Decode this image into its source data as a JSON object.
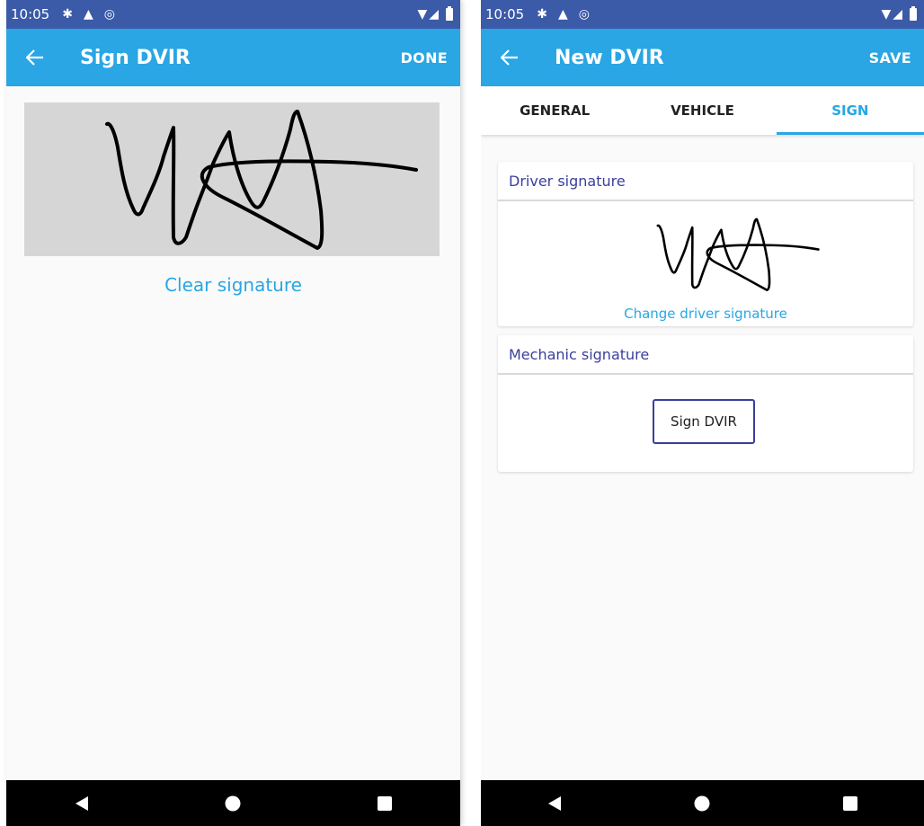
{
  "left": {
    "status_bar": {
      "time": "10:05",
      "icons": [
        "settings-icon",
        "alert-icon",
        "location-icon",
        "wifi-icon",
        "signal-icon",
        "battery-icon"
      ]
    },
    "app_bar": {
      "title": "Sign DVIR",
      "action": "DONE",
      "back_icon": "arrow-back-icon"
    },
    "clear_signature_label": "Clear signature",
    "nav_bar": {
      "icons": [
        "back-triangle-icon",
        "home-circle-icon",
        "recents-square-icon"
      ]
    }
  },
  "right": {
    "status_bar": {
      "time": "10:05",
      "icons": [
        "settings-icon",
        "alert-icon",
        "location-icon",
        "wifi-icon",
        "signal-icon",
        "battery-icon"
      ]
    },
    "app_bar": {
      "title": "New DVIR",
      "action": "SAVE",
      "back_icon": "arrow-back-icon"
    },
    "tabs": [
      {
        "label": "GENERAL",
        "active": false
      },
      {
        "label": "VEHICLE",
        "active": false
      },
      {
        "label": "SIGN",
        "active": true
      }
    ],
    "driver_card": {
      "header": "Driver signature",
      "change_label": "Change driver signature"
    },
    "mechanic_card": {
      "header": "Mechanic signature",
      "button_label": "Sign DVIR"
    },
    "nav_bar": {
      "icons": [
        "back-triangle-icon",
        "home-circle-icon",
        "recents-square-icon"
      ]
    }
  },
  "colors": {
    "status_bar": "#3b5aa8",
    "app_bar": "#29a6e3",
    "accent": "#29a6e3",
    "card_header_text": "#3a3f9c",
    "signature_pad": "#d6d6d6"
  }
}
